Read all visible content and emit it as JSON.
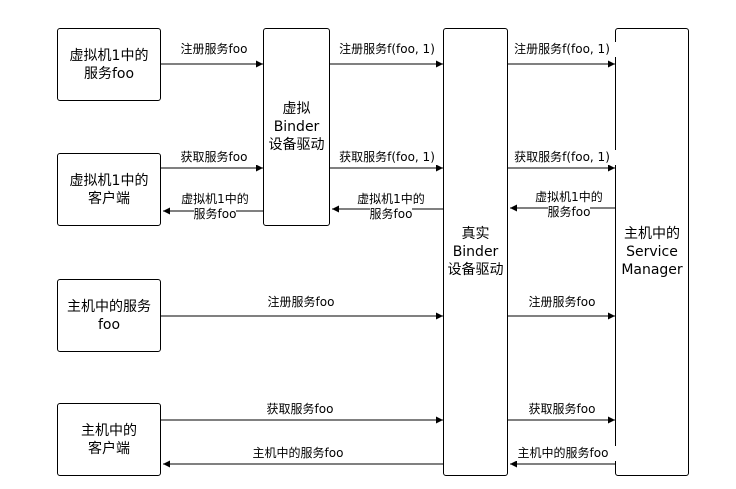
{
  "boxes": {
    "vm_service": [
      "虚拟机1中的",
      "服务foo"
    ],
    "vm_client": [
      "虚拟机1中的",
      "客户端"
    ],
    "host_service": [
      "主机中的服务",
      "foo"
    ],
    "host_client": [
      "主机中的",
      "客户端"
    ],
    "virtual_binder": [
      "虚拟",
      "Binder",
      "设备驱动"
    ],
    "real_binder": [
      "真实",
      "Binder",
      "设备驱动"
    ],
    "service_manager": [
      "主机中的",
      "Service",
      "Manager"
    ]
  },
  "labels": {
    "a1": "注册服务foo",
    "a2": "注册服务f(foo, 1)",
    "a3": "注册服务f(foo, 1)",
    "a4": "获取服务foo",
    "a5": "获取服务f(foo, 1)",
    "a6": "获取服务f(foo, 1)",
    "a7": [
      "虚拟机1中的",
      "服务foo"
    ],
    "a8": [
      "虚拟机1中的",
      "服务foo"
    ],
    "a9": [
      "虚拟机1中的",
      "服务foo"
    ],
    "a10": "注册服务foo",
    "a11": "注册服务foo",
    "a12": "获取服务foo",
    "a13": "获取服务foo",
    "a14": "主机中的服务foo",
    "a15": "主机中的服务foo"
  }
}
